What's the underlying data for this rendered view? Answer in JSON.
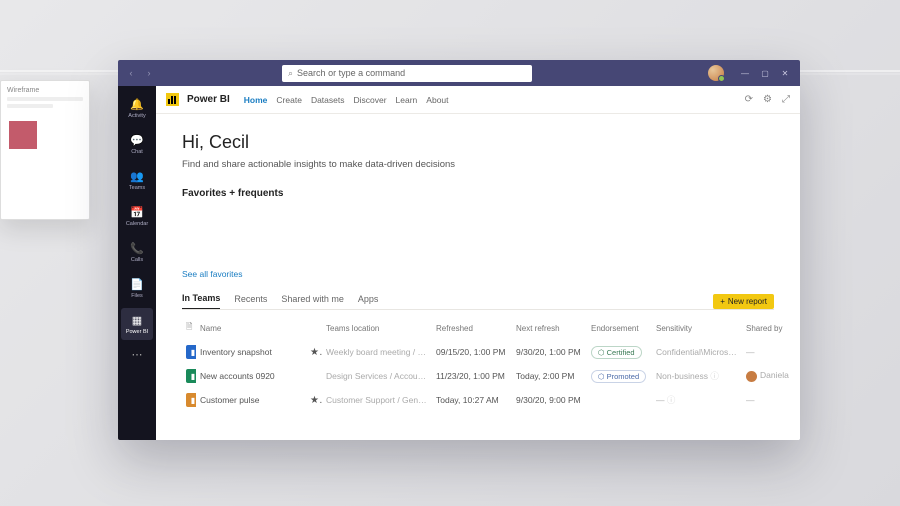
{
  "search": {
    "placeholder": "Search or type a command"
  },
  "window_controls": {
    "min": "—",
    "max": "▢",
    "close": "✕"
  },
  "rail": [
    {
      "icon": "🔔",
      "label": "Activity"
    },
    {
      "icon": "💬",
      "label": "Chat"
    },
    {
      "icon": "👥",
      "label": "Teams"
    },
    {
      "icon": "📅",
      "label": "Calendar"
    },
    {
      "icon": "📞",
      "label": "Calls"
    },
    {
      "icon": "📄",
      "label": "Files"
    },
    {
      "icon": "▦",
      "label": "Power BI"
    }
  ],
  "pb": {
    "title": "Power BI",
    "tabs": [
      "Home",
      "Create",
      "Datasets",
      "Discover",
      "Learn",
      "About"
    ],
    "active_tab": "Home"
  },
  "section": {
    "greeting": "Hi, Cecil",
    "subtitle": "Find and share actionable insights to make data-driven decisions",
    "fav_header": "Favorites + frequents",
    "see_all": "See all favorites"
  },
  "list": {
    "tabs": [
      "In Teams",
      "Recents",
      "Shared with me",
      "Apps"
    ],
    "active": "In Teams",
    "new_report": "New report",
    "columns": [
      "Name",
      "Teams location",
      "Refreshed",
      "Next refresh",
      "Endorsement",
      "Sensitivity",
      "Shared by"
    ],
    "rows": [
      {
        "color": "blue",
        "name": "Inventory snapshot",
        "star": true,
        "location": "Weekly board meeting / General",
        "refreshed": "09/15/20, 1:00 PM",
        "next": "9/30/20, 1:00 PM",
        "endorsement": "Certified",
        "endorse_kind": "cert",
        "sensitivity": "Confidential\\Microsof…",
        "shared": "—"
      },
      {
        "color": "green",
        "name": "New accounts 0920",
        "star": false,
        "location": "Design Services / Accounts",
        "refreshed": "11/23/20, 1:00 PM",
        "next": "Today, 2:00 PM",
        "endorsement": "Promoted",
        "endorse_kind": "prom",
        "sensitivity": "Non-business",
        "shared": "Daniela"
      },
      {
        "color": "orange",
        "name": "Customer pulse",
        "star": true,
        "location": "Customer Support / General",
        "refreshed": "Today, 10:27 AM",
        "next": "9/30/20, 9:00 PM",
        "endorsement": "",
        "endorse_kind": "",
        "sensitivity": "—",
        "shared": "—"
      }
    ]
  }
}
